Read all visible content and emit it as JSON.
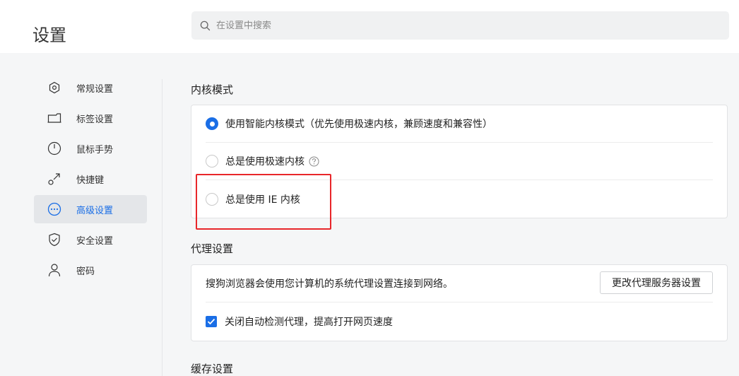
{
  "header": {
    "title": "设置",
    "search_placeholder": "在设置中搜索"
  },
  "sidebar": {
    "items": [
      {
        "label": "常规设置",
        "icon": "hexagon-icon"
      },
      {
        "label": "标签设置",
        "icon": "tab-icon"
      },
      {
        "label": "鼠标手势",
        "icon": "mouse-icon"
      },
      {
        "label": "快捷键",
        "icon": "shortcut-icon"
      },
      {
        "label": "高级设置",
        "icon": "more-circle-icon",
        "active": true
      },
      {
        "label": "安全设置",
        "icon": "shield-icon"
      },
      {
        "label": "密码",
        "icon": "user-icon"
      }
    ]
  },
  "kernel": {
    "title": "内核模式",
    "options": [
      {
        "label": "使用智能内核模式（优先使用极速内核，兼顾速度和兼容性）",
        "selected": true
      },
      {
        "label": "总是使用极速内核",
        "selected": false
      },
      {
        "label": "总是使用 IE 内核",
        "selected": false
      }
    ]
  },
  "proxy": {
    "title": "代理设置",
    "description": "搜狗浏览器会使用您计算机的系统代理设置连接到网络。",
    "button_label": "更改代理服务器设置",
    "checkbox_label": "关闭自动检测代理，提高打开网页速度",
    "checkbox_checked": true
  },
  "cache": {
    "title": "缓存设置"
  },
  "colors": {
    "accent": "#1a6ee6",
    "highlight": "#e8262a"
  }
}
